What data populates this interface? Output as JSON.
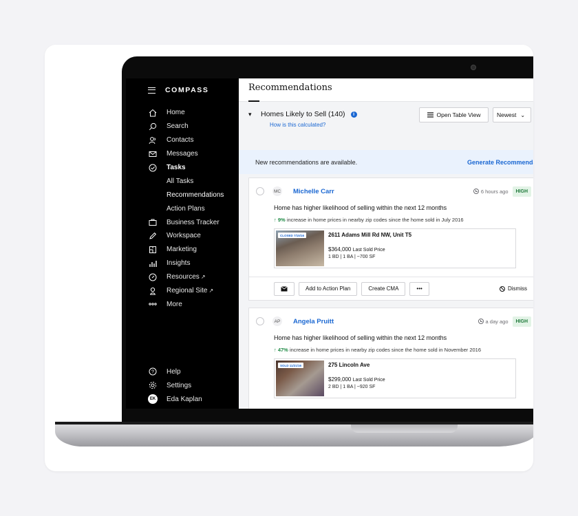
{
  "brand": {
    "logo": "COMPASS"
  },
  "sidebar": {
    "items": [
      {
        "label": "Home",
        "icon": "home-icon"
      },
      {
        "label": "Search",
        "icon": "search-icon"
      },
      {
        "label": "Contacts",
        "icon": "contacts-icon"
      },
      {
        "label": "Messages",
        "icon": "mail-icon"
      },
      {
        "label": "Tasks",
        "icon": "check-circle-icon"
      }
    ],
    "sub_items": [
      "All Tasks",
      "Recommendations",
      "Action Plans"
    ],
    "items2": [
      {
        "label": "Business Tracker",
        "icon": "briefcase-icon"
      },
      {
        "label": "Workspace",
        "icon": "pen-icon"
      },
      {
        "label": "Marketing",
        "icon": "marketing-icon"
      },
      {
        "label": "Insights",
        "icon": "bar-chart-icon"
      },
      {
        "label": "Resources",
        "icon": "compass-icon"
      },
      {
        "label": "Regional Site",
        "icon": "regional-icon"
      },
      {
        "label": "More",
        "icon": "more-dots-icon"
      }
    ],
    "bottom": [
      {
        "label": "Help",
        "icon": "help-icon"
      },
      {
        "label": "Settings",
        "icon": "gear-icon"
      }
    ],
    "user": {
      "initials": "EK",
      "name": "Eda Kaplan"
    }
  },
  "main": {
    "title": "Recommendations",
    "section_title": "Homes Likely to Sell (140)",
    "how_link": "How is this calculated?",
    "table_view": "Open Table View",
    "sort": "Newest",
    "banner_text": "New recommendations are available.",
    "banner_link": "Generate Recommendations",
    "cards": [
      {
        "initials": "MC",
        "name": "Michelle Carr",
        "time": "6 hours ago",
        "badge": "HIGH",
        "headline": "Home has higher likelihood of selling within the next 12 months",
        "pct": "↑ 9%",
        "detail": " increase in home prices in nearby zip codes since the home sold in July 2016",
        "stamp": "CLOSED 7/15/16",
        "address": "2611 Adams Mill Rd NW, Unit T5",
        "price": "$364,000",
        "price_label": "Last Sold Price",
        "beds": "1 BD  |  1 BA  |  ~700 SF"
      },
      {
        "initials": "AP",
        "name": "Angela Pruitt",
        "time": "a day ago",
        "badge": "HIGH",
        "headline": "Home has higher likelihood of selling within the next 12 months",
        "pct": "↑ 47%",
        "detail": " increase in home prices in nearby zip codes since the home sold in November 2016",
        "stamp": "SOLD 11/21/16",
        "address": "275 Lincoln Ave",
        "price": "$299,000",
        "price_label": "Last Sold Price",
        "beds": "2 BD  |  1 BA  |  ~920 SF"
      }
    ],
    "actions": {
      "add": "Add to Action Plan",
      "cma": "Create CMA",
      "more": "•••",
      "dismiss": "Dismiss"
    }
  }
}
